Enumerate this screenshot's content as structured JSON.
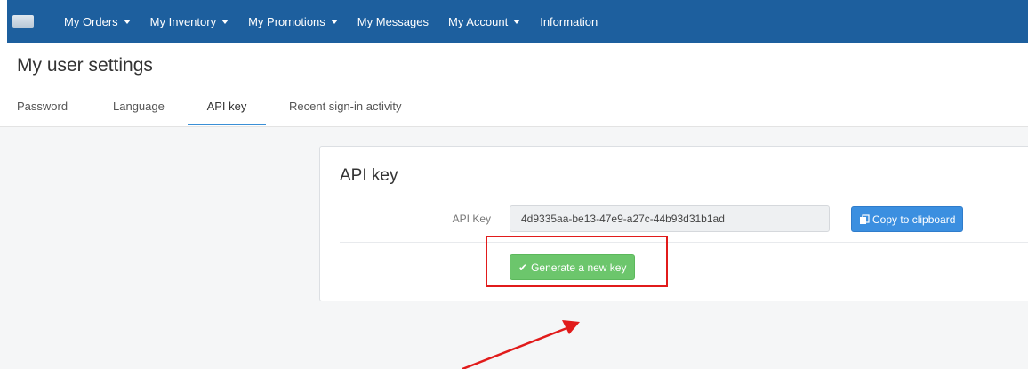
{
  "navbar": {
    "logo_icon": "app-logo-icon",
    "items": [
      {
        "label": "My Orders",
        "dropdown": true
      },
      {
        "label": "My Inventory",
        "dropdown": true
      },
      {
        "label": "My Promotions",
        "dropdown": true
      },
      {
        "label": "My Messages",
        "dropdown": false
      },
      {
        "label": "My Account",
        "dropdown": true
      },
      {
        "label": "Information",
        "dropdown": false
      }
    ],
    "background_color": "#1d5f9e"
  },
  "page": {
    "title": "My user settings"
  },
  "tabs": [
    {
      "label": "Password",
      "active": false
    },
    {
      "label": "Language",
      "active": false
    },
    {
      "label": "API key",
      "active": true
    },
    {
      "label": "Recent sign-in activity",
      "active": false
    }
  ],
  "api_card": {
    "title": "API key",
    "field_label": "API Key",
    "api_key_value": "4d9335aa-be13-47e9-a27c-44b93d31b1ad",
    "copy_button": {
      "label": "Copy to clipboard",
      "icon": "clipboard-icon",
      "color": "#3b8fe0"
    },
    "generate_button": {
      "label": "Generate a new key",
      "icon": "check-icon",
      "color": "#6cc66c"
    }
  },
  "annotation": {
    "highlight_color": "#e11b1b",
    "arrow_icon": "red-arrow-icon"
  }
}
